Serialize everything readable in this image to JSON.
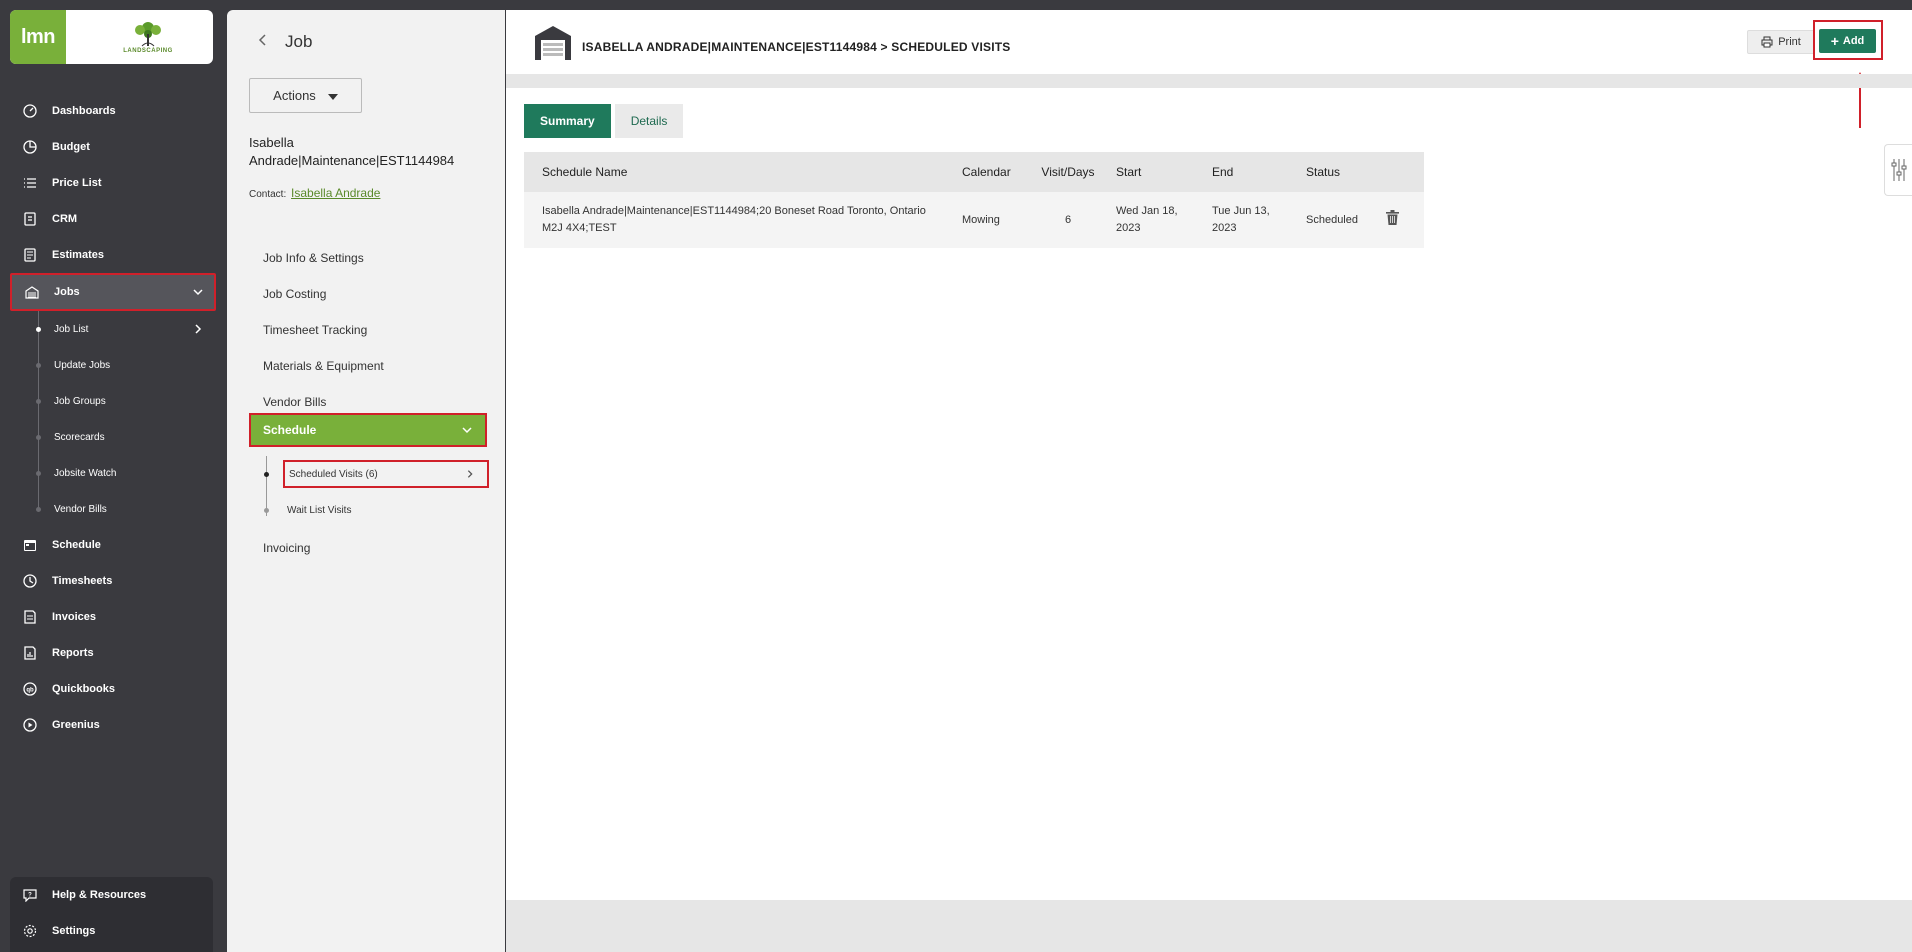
{
  "app": {
    "logo_text": "lmn",
    "company_logo_text": "LANDSCAPING"
  },
  "sidebar": {
    "items": [
      {
        "label": "Dashboards",
        "icon": "dashboard-icon"
      },
      {
        "label": "Budget",
        "icon": "budget-icon"
      },
      {
        "label": "Price List",
        "icon": "list-icon"
      },
      {
        "label": "CRM",
        "icon": "crm-icon"
      },
      {
        "label": "Estimates",
        "icon": "estimates-icon"
      },
      {
        "label": "Jobs",
        "icon": "jobs-icon"
      }
    ],
    "jobs_subitems": [
      {
        "label": "Job List"
      },
      {
        "label": "Update Jobs"
      },
      {
        "label": "Job Groups"
      },
      {
        "label": "Scorecards"
      },
      {
        "label": "Jobsite Watch"
      },
      {
        "label": "Vendor Bills"
      }
    ],
    "items_after": [
      {
        "label": "Schedule",
        "icon": "calendar-icon"
      },
      {
        "label": "Timesheets",
        "icon": "clock-icon"
      },
      {
        "label": "Invoices",
        "icon": "invoice-icon"
      },
      {
        "label": "Reports",
        "icon": "report-icon"
      },
      {
        "label": "Quickbooks",
        "icon": "quickbooks-icon"
      },
      {
        "label": "Greenius",
        "icon": "play-icon"
      }
    ],
    "bottom": [
      {
        "label": "Help & Resources",
        "icon": "help-icon"
      },
      {
        "label": "Settings",
        "icon": "gear-icon"
      }
    ]
  },
  "job_panel": {
    "title": "Job",
    "actions_label": "Actions",
    "job_name": "Isabella Andrade|Maintenance|EST1144984",
    "contact_label": "Contact:",
    "contact_name": "Isabella Andrade",
    "menu": [
      {
        "label": "Job Info & Settings"
      },
      {
        "label": "Job Costing"
      },
      {
        "label": "Timesheet Tracking"
      },
      {
        "label": "Materials & Equipment"
      },
      {
        "label": "Vendor Bills"
      }
    ],
    "schedule_label": "Schedule",
    "schedule_sub": [
      {
        "label": "Scheduled Visits (6)"
      },
      {
        "label": "Wait List Visits"
      }
    ],
    "invoicing_label": "Invoicing"
  },
  "main": {
    "breadcrumb": "ISABELLA ANDRADE|MAINTENANCE|EST1144984 > SCHEDULED VISITS",
    "print_label": "Print",
    "add_label": "Add",
    "tabs": [
      {
        "label": "Summary"
      },
      {
        "label": "Details"
      }
    ],
    "table": {
      "headers": [
        "Schedule Name",
        "Calendar",
        "Visit/Days",
        "Start",
        "End",
        "Status"
      ],
      "rows": [
        {
          "name": "Isabella Andrade|Maintenance|EST1144984;20 Boneset Road Toronto, Ontario M2J 4X4;TEST",
          "calendar": "Mowing",
          "visit_days": "6",
          "start": "Wed Jan 18, 2023",
          "end": "Tue Jun 13, 2023",
          "status": "Scheduled"
        }
      ]
    }
  },
  "colors": {
    "sidebar_bg": "#3a3a3f",
    "brand_green": "#79b03a",
    "accent_teal": "#1f7a5c",
    "highlight_red": "#d0202a"
  }
}
